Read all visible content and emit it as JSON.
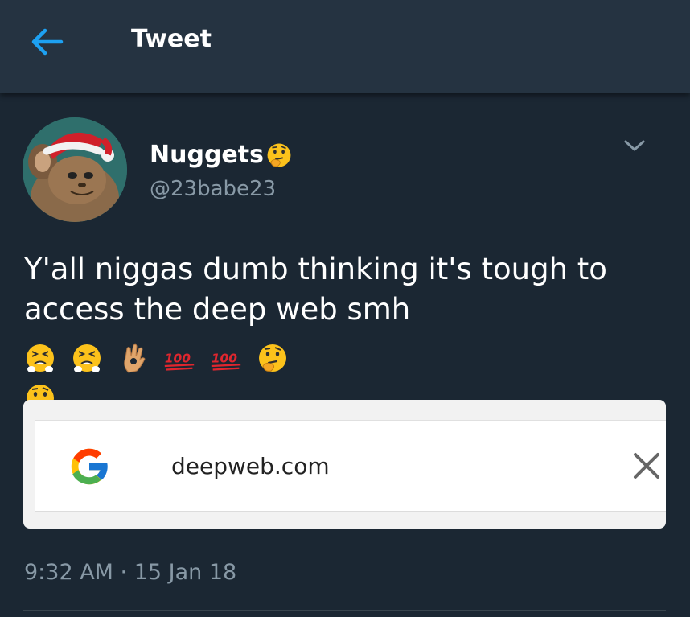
{
  "header": {
    "title": "Tweet",
    "back_icon": "arrow-left-icon"
  },
  "author": {
    "display_name": "Nuggets",
    "name_emoji": "thinking-face-emoji",
    "handle": "@23babe23",
    "avatar": "mouse-with-santa-hat-avatar"
  },
  "tweet": {
    "line1": "Y'all niggas dumb thinking it's tough to",
    "line2": "access the deep web smh",
    "emojis": [
      "persevering-face-emoji",
      "persevering-face-emoji",
      "ok-hand-emoji",
      "hundred-points-emoji",
      "hundred-points-emoji",
      "thinking-face-emoji",
      "thinking-face-emoji"
    ],
    "hundred_label": "100"
  },
  "card": {
    "search_query": "deepweb.com",
    "logo": "google-g-icon",
    "close_icon": "close-icon"
  },
  "meta": {
    "timestamp": "9:32 AM · 15 Jan 18"
  },
  "colors": {
    "accent": "#1da1f2",
    "background": "#1b2733",
    "header": "#253341",
    "secondary_text": "#8899a6"
  }
}
